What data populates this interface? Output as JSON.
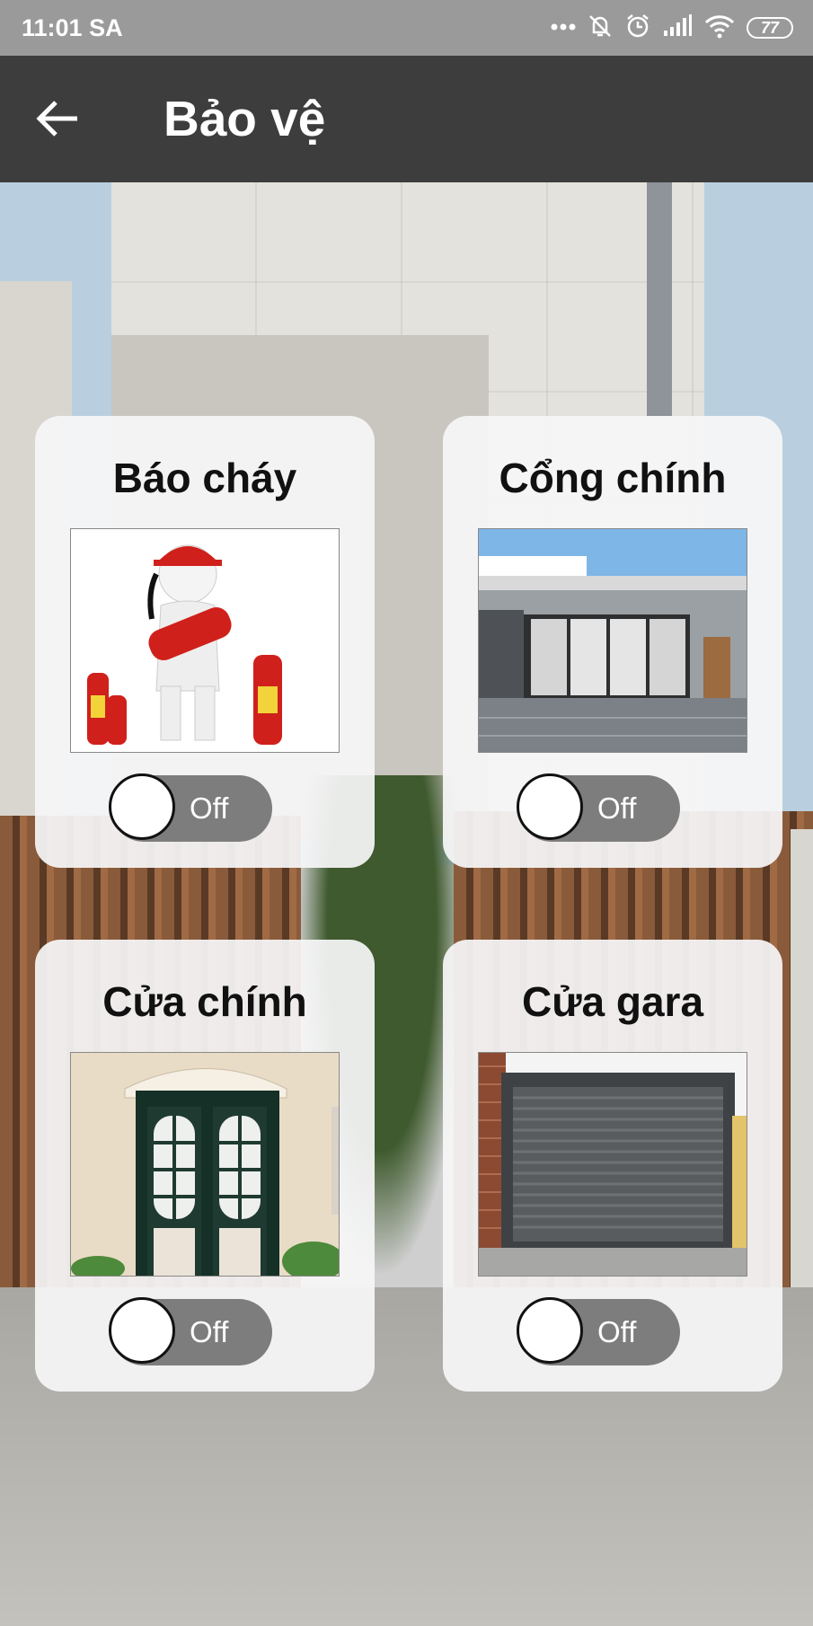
{
  "status_bar": {
    "time": "11:01 SA",
    "battery": "77"
  },
  "app_bar": {
    "title": "Bảo vệ"
  },
  "cards": [
    {
      "title": "Báo cháy",
      "switch_label": "Off",
      "switch_on": false
    },
    {
      "title": "Cổng chính",
      "switch_label": "Off",
      "switch_on": false
    },
    {
      "title": "Cửa chính",
      "switch_label": "Off",
      "switch_on": false
    },
    {
      "title": "Cửa gara",
      "switch_label": "Off",
      "switch_on": false
    }
  ],
  "colors": {
    "status_bar": "#9a9a9a",
    "app_bar": "#3d3d3d",
    "switch_track": "#7d7d7d"
  }
}
